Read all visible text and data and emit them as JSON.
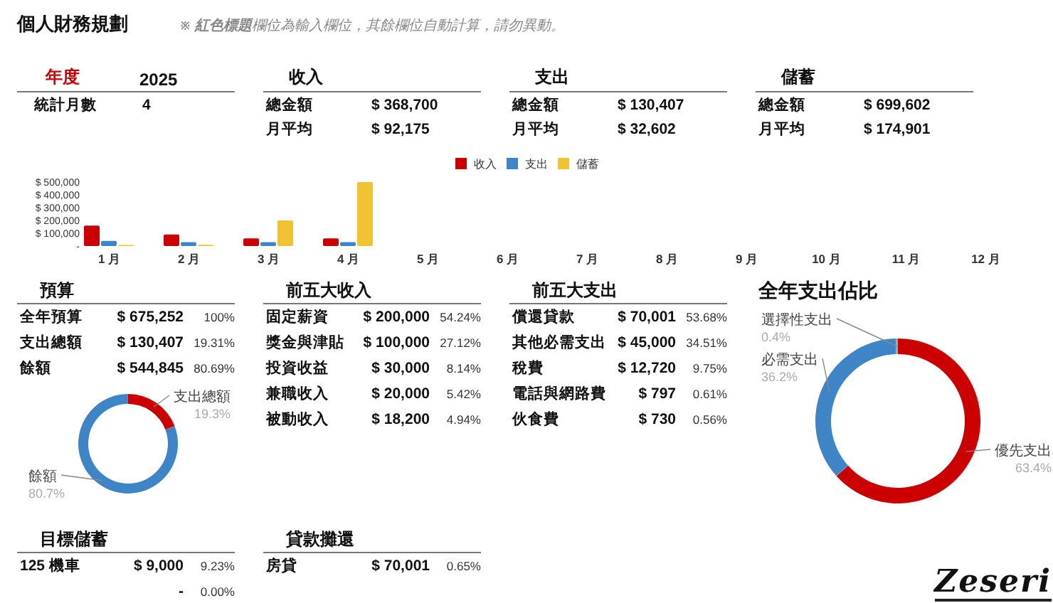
{
  "title": "個人財務規劃",
  "note": "※ **紅色標題**欄位為輸入欄位，其餘欄位自動計算，請勿異動。",
  "summary": [
    {
      "kind": "input",
      "label": "年度",
      "value": "2025",
      "rows": [
        {
          "label": "統計月數",
          "value": "4"
        }
      ]
    },
    {
      "kind": "computed",
      "label": "收入",
      "rows": [
        {
          "label": "總金額",
          "value": "$ 368,700"
        },
        {
          "label": "月平均",
          "value": "$ 92,175"
        }
      ]
    },
    {
      "kind": "computed",
      "label": "支出",
      "rows": [
        {
          "label": "總金額",
          "value": "$ 130,407"
        },
        {
          "label": "月平均",
          "value": "$ 32,602"
        }
      ]
    },
    {
      "kind": "computed",
      "label": "儲蓄",
      "rows": [
        {
          "label": "總金額",
          "value": "$ 699,602"
        },
        {
          "label": "月平均",
          "value": "$ 174,901"
        }
      ]
    }
  ],
  "monthly_chart": {
    "chart_data": {
      "type": "bar",
      "categories": [
        "1 月",
        "2 月",
        "3 月",
        "4 月",
        "5 月",
        "6 月",
        "7 月",
        "8 月",
        "9 月",
        "10 月",
        "11 月",
        "12 月"
      ],
      "series": [
        {
          "name": "收入",
          "color": "#cc0000",
          "values": [
            160000,
            90000,
            60000,
            60000,
            null,
            null,
            null,
            null,
            null,
            null,
            null,
            null
          ]
        },
        {
          "name": "支出",
          "color": "#3d85c6",
          "values": [
            40000,
            30000,
            30000,
            30000,
            null,
            null,
            null,
            null,
            null,
            null,
            null,
            null
          ]
        },
        {
          "name": "儲蓄",
          "color": "#f1c232",
          "values": [
            0,
            10000,
            200000,
            500000,
            null,
            null,
            null,
            null,
            null,
            null,
            null,
            null
          ]
        }
      ],
      "legend": true,
      "ylim": [
        0,
        500000
      ],
      "yticks": [
        {
          "value": 0,
          "label": "-"
        },
        {
          "value": 100000,
          "label": "$ 100,000"
        },
        {
          "value": 200000,
          "label": "$ 200,000"
        },
        {
          "value": 300000,
          "label": "$ 300,000"
        },
        {
          "value": 400000,
          "label": "$ 400,000"
        },
        {
          "value": 500000,
          "label": "$ 500,000"
        }
      ]
    }
  },
  "budget": {
    "title": "預算",
    "rows": [
      {
        "label": "全年預算",
        "value": "$ 675,252",
        "share": "100%"
      },
      {
        "label": "支出總額",
        "value": "$ 130,407",
        "share": "19.31%"
      },
      {
        "label": "餘額",
        "value": "$ 544,845",
        "share": "80.69%"
      }
    ],
    "chart_data": {
      "type": "donut",
      "categories": [
        "支出總額",
        "餘額"
      ],
      "values": [
        19.3,
        80.7
      ],
      "value_labels": [
        "19.3%",
        "80.7%"
      ]
    }
  },
  "top_income": {
    "title": "前五大收入",
    "rows": [
      {
        "label": "固定薪資",
        "value": "$ 200,000",
        "share": "54.24%"
      },
      {
        "label": "獎金與津貼",
        "value": "$ 100,000",
        "share": "27.12%"
      },
      {
        "label": "投資收益",
        "value": "$ 30,000",
        "share": "8.14%"
      },
      {
        "label": "兼職收入",
        "value": "$ 20,000",
        "share": "5.42%"
      },
      {
        "label": "被動收入",
        "value": "$ 18,200",
        "share": "4.94%"
      }
    ]
  },
  "top_expenses": {
    "title": "前五大支出",
    "rows": [
      {
        "label": "償還貸款",
        "value": "$ 70,001",
        "share": "53.68%"
      },
      {
        "label": "其他必需支出",
        "value": "$ 45,000",
        "share": "34.51%"
      },
      {
        "label": "稅費",
        "value": "$ 12,720",
        "share": "9.75%"
      },
      {
        "label": "電話與網路費",
        "value": "$ 797",
        "share": "0.61%"
      },
      {
        "label": "伙食費",
        "value": "$ 730",
        "share": "0.56%"
      }
    ]
  },
  "expense_breakdown": {
    "title": "全年支出佔比",
    "chart_data": {
      "type": "donut",
      "categories": [
        "優先支出",
        "必需支出",
        "選擇性支出"
      ],
      "values": [
        63.4,
        36.2,
        0.4
      ],
      "value_labels": [
        "63.4%",
        "36.2%",
        "0.4%"
      ]
    }
  },
  "savings_goals": {
    "title": "目標儲蓄",
    "rows": [
      {
        "label": "125 機車",
        "value": "$ 9,000",
        "share": "9.23%"
      },
      {
        "value": "-",
        "share": "0.00%"
      }
    ]
  },
  "loans": {
    "title": "貸款攤還",
    "rows": [
      {
        "label": "房貸",
        "value": "$ 70,001",
        "share": "0.65%"
      }
    ]
  },
  "logo": "Zeseri"
}
